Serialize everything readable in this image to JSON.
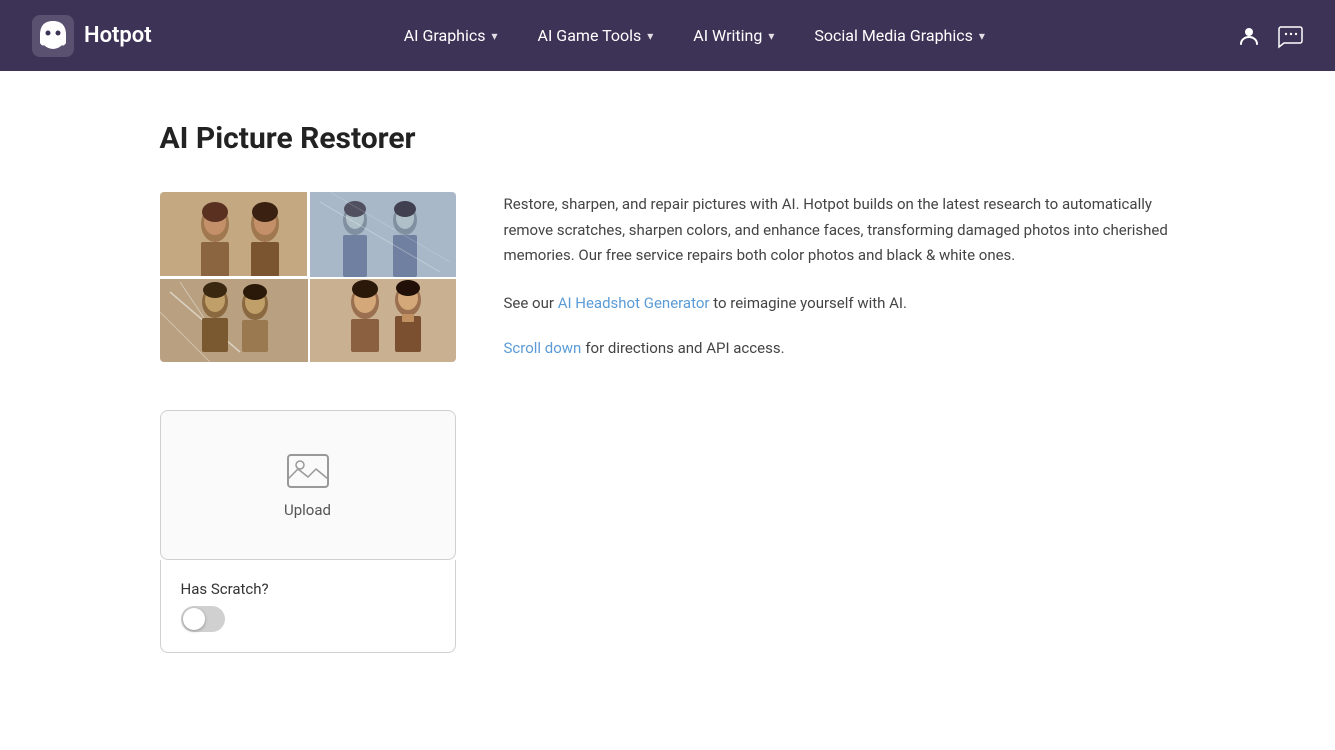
{
  "brand": {
    "name": "Hotpot",
    "logo_alt": "Hotpot logo"
  },
  "nav": {
    "items": [
      {
        "label": "AI Graphics",
        "has_dropdown": true
      },
      {
        "label": "AI Game Tools",
        "has_dropdown": true
      },
      {
        "label": "AI Writing",
        "has_dropdown": true
      },
      {
        "label": "Social Media Graphics",
        "has_dropdown": true
      }
    ]
  },
  "page": {
    "title": "AI Picture Restorer"
  },
  "description": {
    "paragraph1": "Restore, sharpen, and repair pictures with AI. Hotpot builds on the latest research to automatically remove scratches, sharpen colors, and enhance faces, transforming damaged photos into cherished memories. Our free service repairs both color photos and black & white ones.",
    "see_our": "See our",
    "headshot_link": "AI Headshot Generator",
    "headshot_suffix": " to reimagine yourself with AI.",
    "scroll_link": "Scroll down",
    "scroll_suffix": " for directions and API access."
  },
  "upload": {
    "label": "Upload"
  },
  "options": {
    "has_scratch_label": "Has Scratch?"
  },
  "icons": {
    "user": "👤",
    "chat": "💬",
    "chevron": "▾",
    "upload_image": "🖼"
  }
}
